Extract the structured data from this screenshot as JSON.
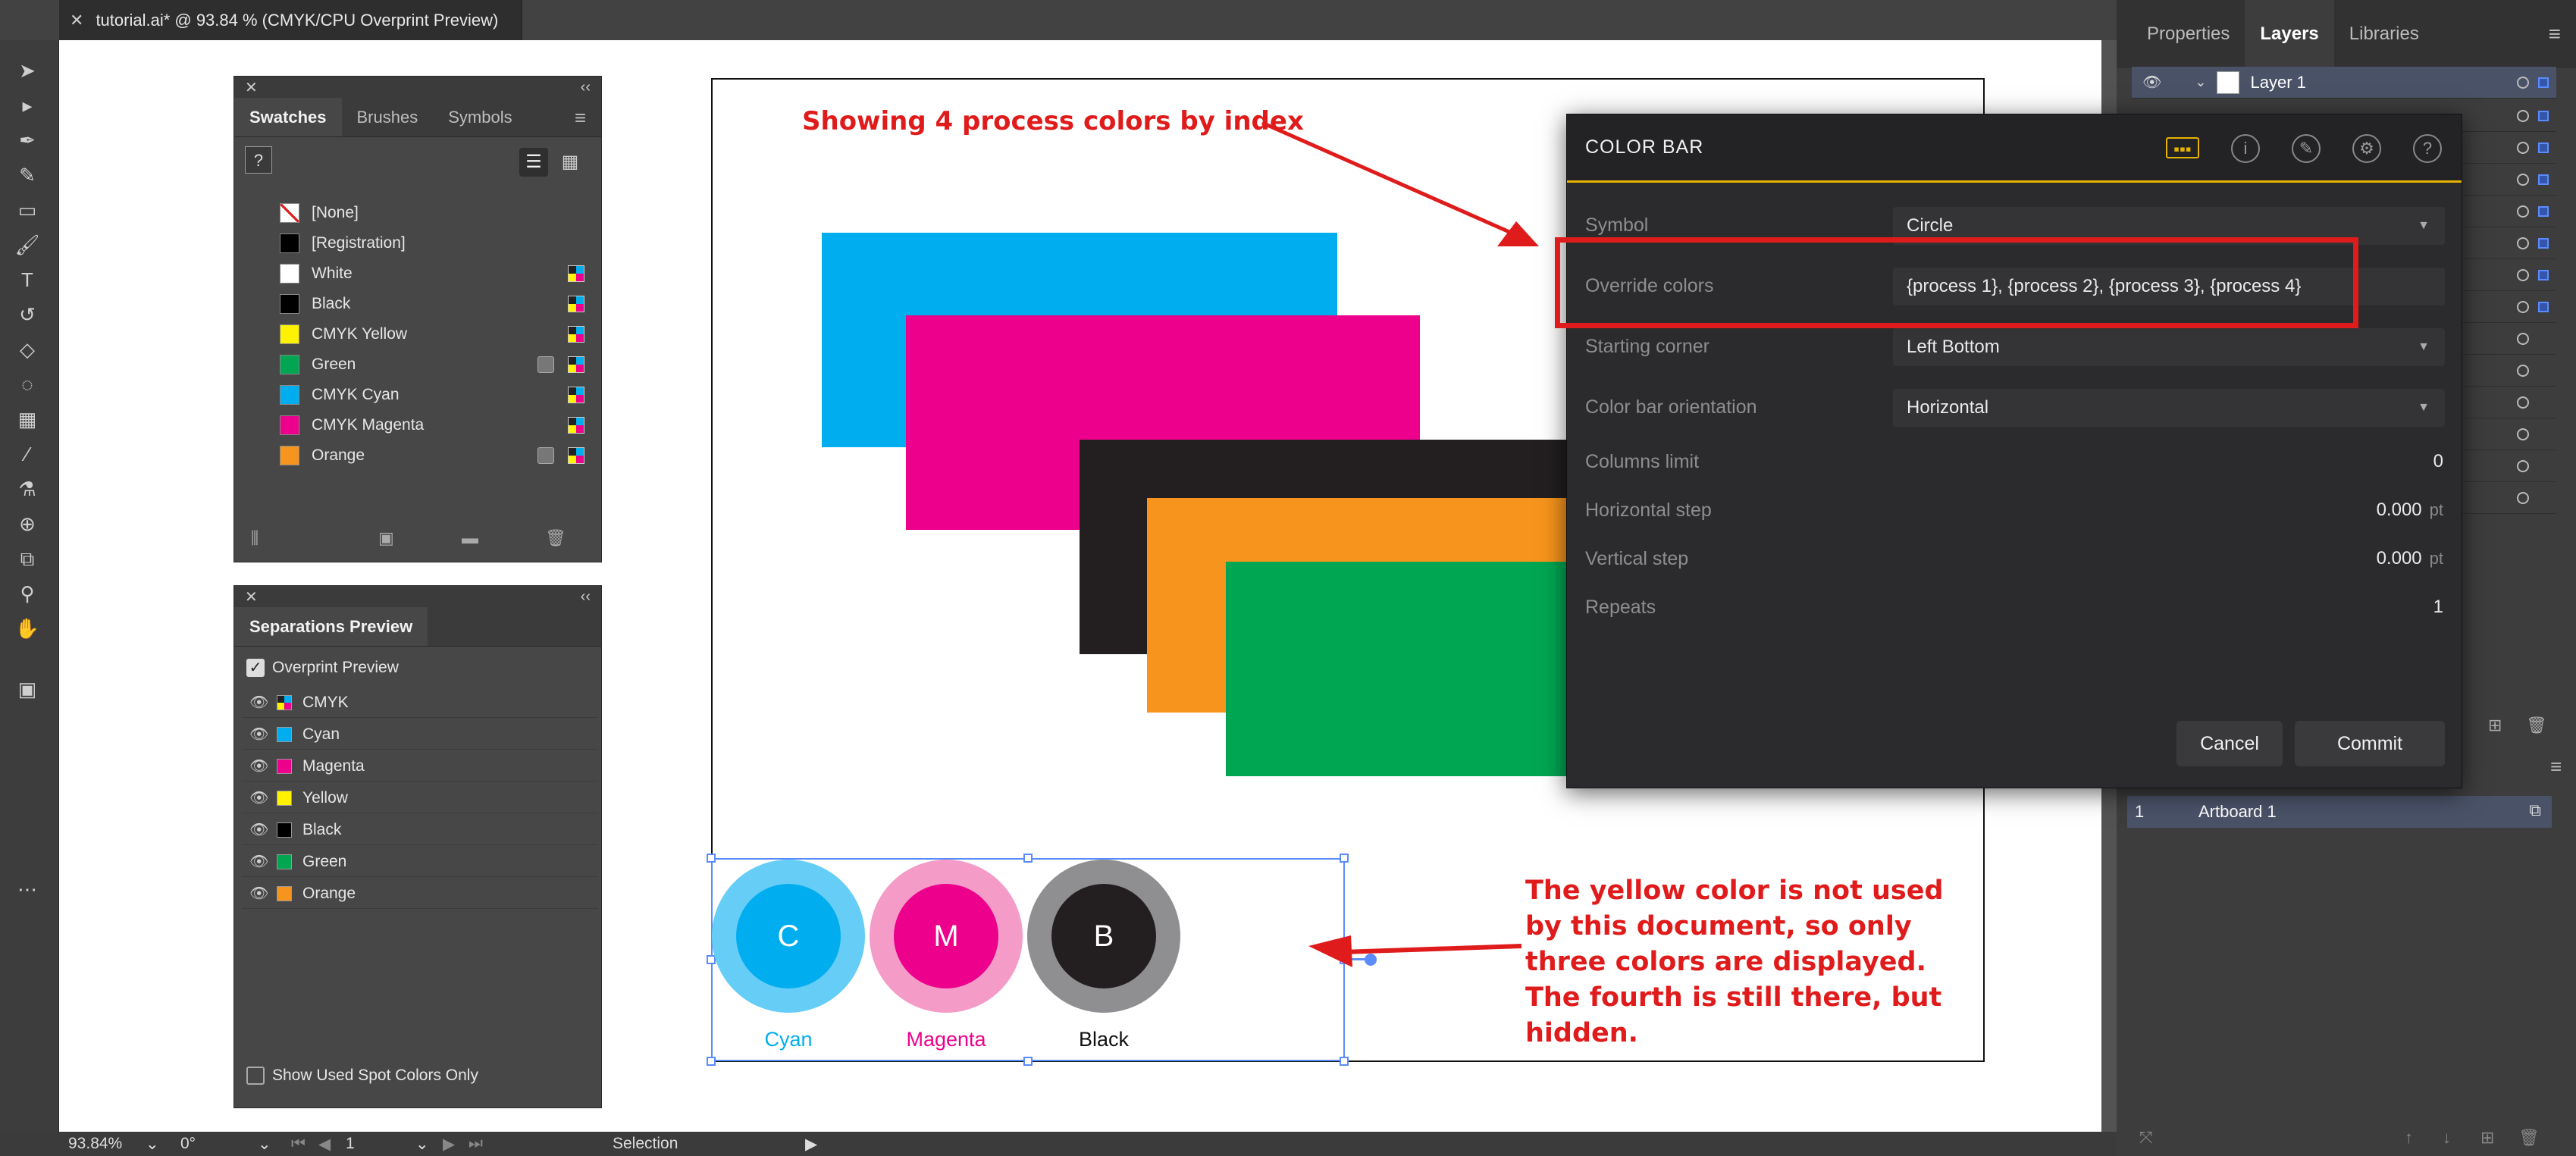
{
  "document": {
    "tab_title": "tutorial.ai* @ 93.84 % (CMYK/CPU Overprint Preview)",
    "close_glyph": "✕"
  },
  "swatches_panel": {
    "tabs": [
      "Swatches",
      "Brushes",
      "Symbols"
    ],
    "items": [
      {
        "name": "[None]",
        "color": "none"
      },
      {
        "name": "[Registration]",
        "color": "#000000"
      },
      {
        "name": "White",
        "color": "#ffffff"
      },
      {
        "name": "Black",
        "color": "#000000"
      },
      {
        "name": "CMYK Yellow",
        "color": "#fff200"
      },
      {
        "name": "Green",
        "color": "#00a651"
      },
      {
        "name": "CMYK Cyan",
        "color": "#00aeef"
      },
      {
        "name": "CMYK Magenta",
        "color": "#ec008c"
      },
      {
        "name": "Orange",
        "color": "#f7941d"
      }
    ]
  },
  "separations_panel": {
    "title": "Separations Preview",
    "overprint_label": "Overprint Preview",
    "overprint_checked": true,
    "items": [
      {
        "name": "CMYK",
        "color": "cmyk"
      },
      {
        "name": "Cyan",
        "color": "#00aeef"
      },
      {
        "name": "Magenta",
        "color": "#ec008c"
      },
      {
        "name": "Yellow",
        "color": "#fff200"
      },
      {
        "name": "Black",
        "color": "#000000"
      },
      {
        "name": "Green",
        "color": "#00a651"
      },
      {
        "name": "Orange",
        "color": "#f7941d"
      }
    ],
    "show_used_label": "Show Used Spot Colors Only"
  },
  "right_panel": {
    "tabs": [
      "Properties",
      "Layers",
      "Libraries"
    ],
    "active_tab": "Layers",
    "layer_name": "Layer 1",
    "artboard_index": "1",
    "artboard_name": "Artboard 1"
  },
  "dialog": {
    "title": "COLOR BAR",
    "symbol_label": "Symbol",
    "symbol_value": "Circle",
    "override_label": "Override colors",
    "override_value": "{process 1}, {process 2}, {process 3}, {process 4}",
    "corner_label": "Starting corner",
    "corner_value": "Left Bottom",
    "orientation_label": "Color bar orientation",
    "orientation_value": "Horizontal",
    "columns_label": "Columns limit",
    "columns_value": "0",
    "hstep_label": "Horizontal step",
    "hstep_value": "0.000",
    "vstep_label": "Vertical step",
    "vstep_value": "0.000",
    "unit": "pt",
    "repeats_label": "Repeats",
    "repeats_value": "1",
    "cancel_label": "Cancel",
    "commit_label": "Commit"
  },
  "artwork": {
    "rect_colors": [
      "#00aeef",
      "#ec008c",
      "#231f20",
      "#f7941d",
      "#00a651"
    ],
    "circles": [
      {
        "letter": "C",
        "label": "Cyan",
        "color": "#00aeef",
        "ring": "#66cdf6"
      },
      {
        "letter": "M",
        "label": "Magenta",
        "color": "#ec008c",
        "ring": "#f49bc7"
      },
      {
        "letter": "B",
        "label": "Black",
        "color": "#231f20",
        "ring": "#8f8f91"
      }
    ]
  },
  "annotations": {
    "top": "Showing 4 process colors by index",
    "bottom": "The yellow color is not used by this document, so only three colors are displayed. The fourth is still there, but hidden.",
    "color": "#e01b1b"
  },
  "status_bar": {
    "zoom": "93.84%",
    "rotation": "0°",
    "page": "1",
    "tool": "Selection"
  }
}
